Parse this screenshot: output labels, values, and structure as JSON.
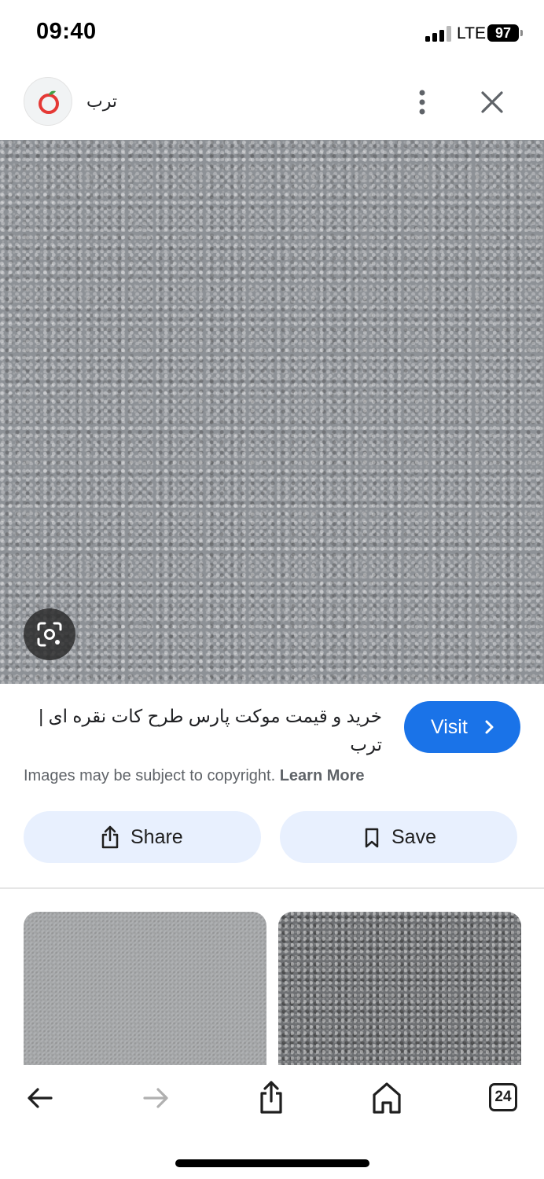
{
  "status_bar": {
    "time": "09:40",
    "network": "LTE",
    "battery": "97"
  },
  "header": {
    "site_name": "ترب",
    "logo_icon": "torob-logo-icon",
    "more_icon": "more-vert-icon",
    "close_icon": "close-icon"
  },
  "image_viewer": {
    "lens_icon": "google-lens-icon"
  },
  "result": {
    "title": "خرید و قیمت موکت پارس طرح کات نقره ای | ترب",
    "visit_label": "Visit",
    "copyright_text": "Images may be subject to copyright.",
    "learn_more_label": "Learn More"
  },
  "actions": {
    "share_label": "Share",
    "save_label": "Save"
  },
  "toolbar": {
    "back_icon": "arrow-left-icon",
    "forward_icon": "arrow-right-icon",
    "share_icon": "share-icon",
    "home_icon": "home-icon",
    "tab_count": "24"
  },
  "colors": {
    "accent": "#1a73e8",
    "pill_bg": "#e8f0fe",
    "logo_red": "#e53935",
    "logo_green": "#43a047"
  }
}
